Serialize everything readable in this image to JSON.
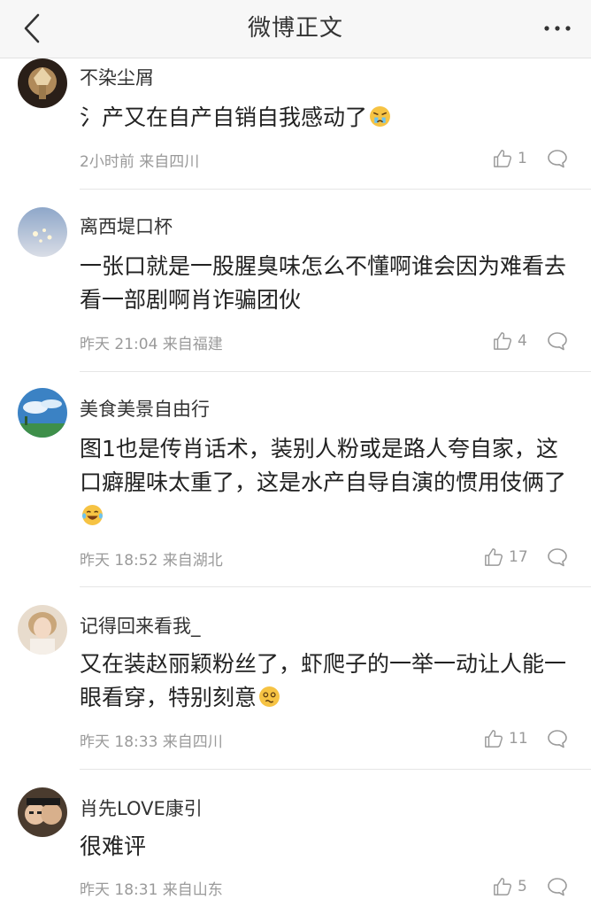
{
  "nav": {
    "title": "微博正文"
  },
  "comments": [
    {
      "username": "不染尘屑",
      "text": "氵产又在自产自销自我感动了",
      "emoji": "pouting-face-emoji",
      "time": "2小时前 来自四川",
      "likes": "1"
    },
    {
      "username": "离西堤口杯",
      "text": "一张口就是一股腥臭味怎么不懂啊谁会因为难看去看一部剧啊肖诈骗团伙",
      "emoji": "",
      "time": "昨天 21:04 来自福建",
      "likes": "4"
    },
    {
      "username": "美食美景自由行",
      "text": "图1也是传肖话术，装别人粉或是路人夸自家，这口癖腥味太重了，这是水产自导自演的惯用伎俩了",
      "emoji": "laughing-tears-emoji",
      "time": "昨天 18:52 来自湖北",
      "likes": "17"
    },
    {
      "username": "记得回来看我_",
      "text": "又在装赵丽颖粉丝了，虾爬子的一举一动让人能一眼看穿，特别刻意",
      "emoji": "dizzy-face-emoji",
      "time": "昨天 18:33 来自四川",
      "likes": "11"
    },
    {
      "username": "肖先LOVE康引",
      "text": "很难评",
      "emoji": "",
      "time": "昨天 18:31 来自山东",
      "likes": "5"
    }
  ],
  "icons": {
    "back": "chevron-left-icon",
    "more": "more-dots-icon",
    "like": "thumb-up-icon",
    "reply": "comment-bubble-icon"
  }
}
